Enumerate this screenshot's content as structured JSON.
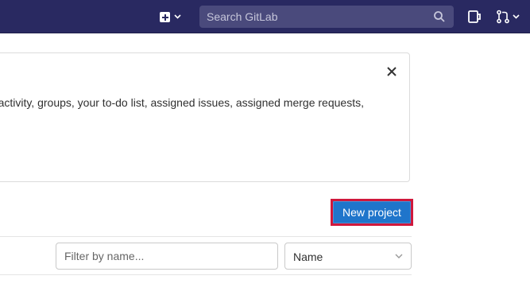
{
  "header": {
    "new_menu_icon": "plus-square-icon",
    "search": {
      "placeholder": "Search GitLab",
      "icon": "search-icon"
    },
    "todo_icon": "todo-icon",
    "merge_requests_icon": "merge-request-icon"
  },
  "alert": {
    "text": "' activity, groups, your to-do list, assigned issues, assigned merge requests,",
    "close_icon": "close-icon"
  },
  "actions": {
    "new_project_label": "New project"
  },
  "filter": {
    "placeholder": "Filter by name...",
    "sort_value": "Name"
  },
  "colors": {
    "topbar": "#292961",
    "primary_button": "#1f75cb",
    "highlight_border": "#d0183c"
  }
}
